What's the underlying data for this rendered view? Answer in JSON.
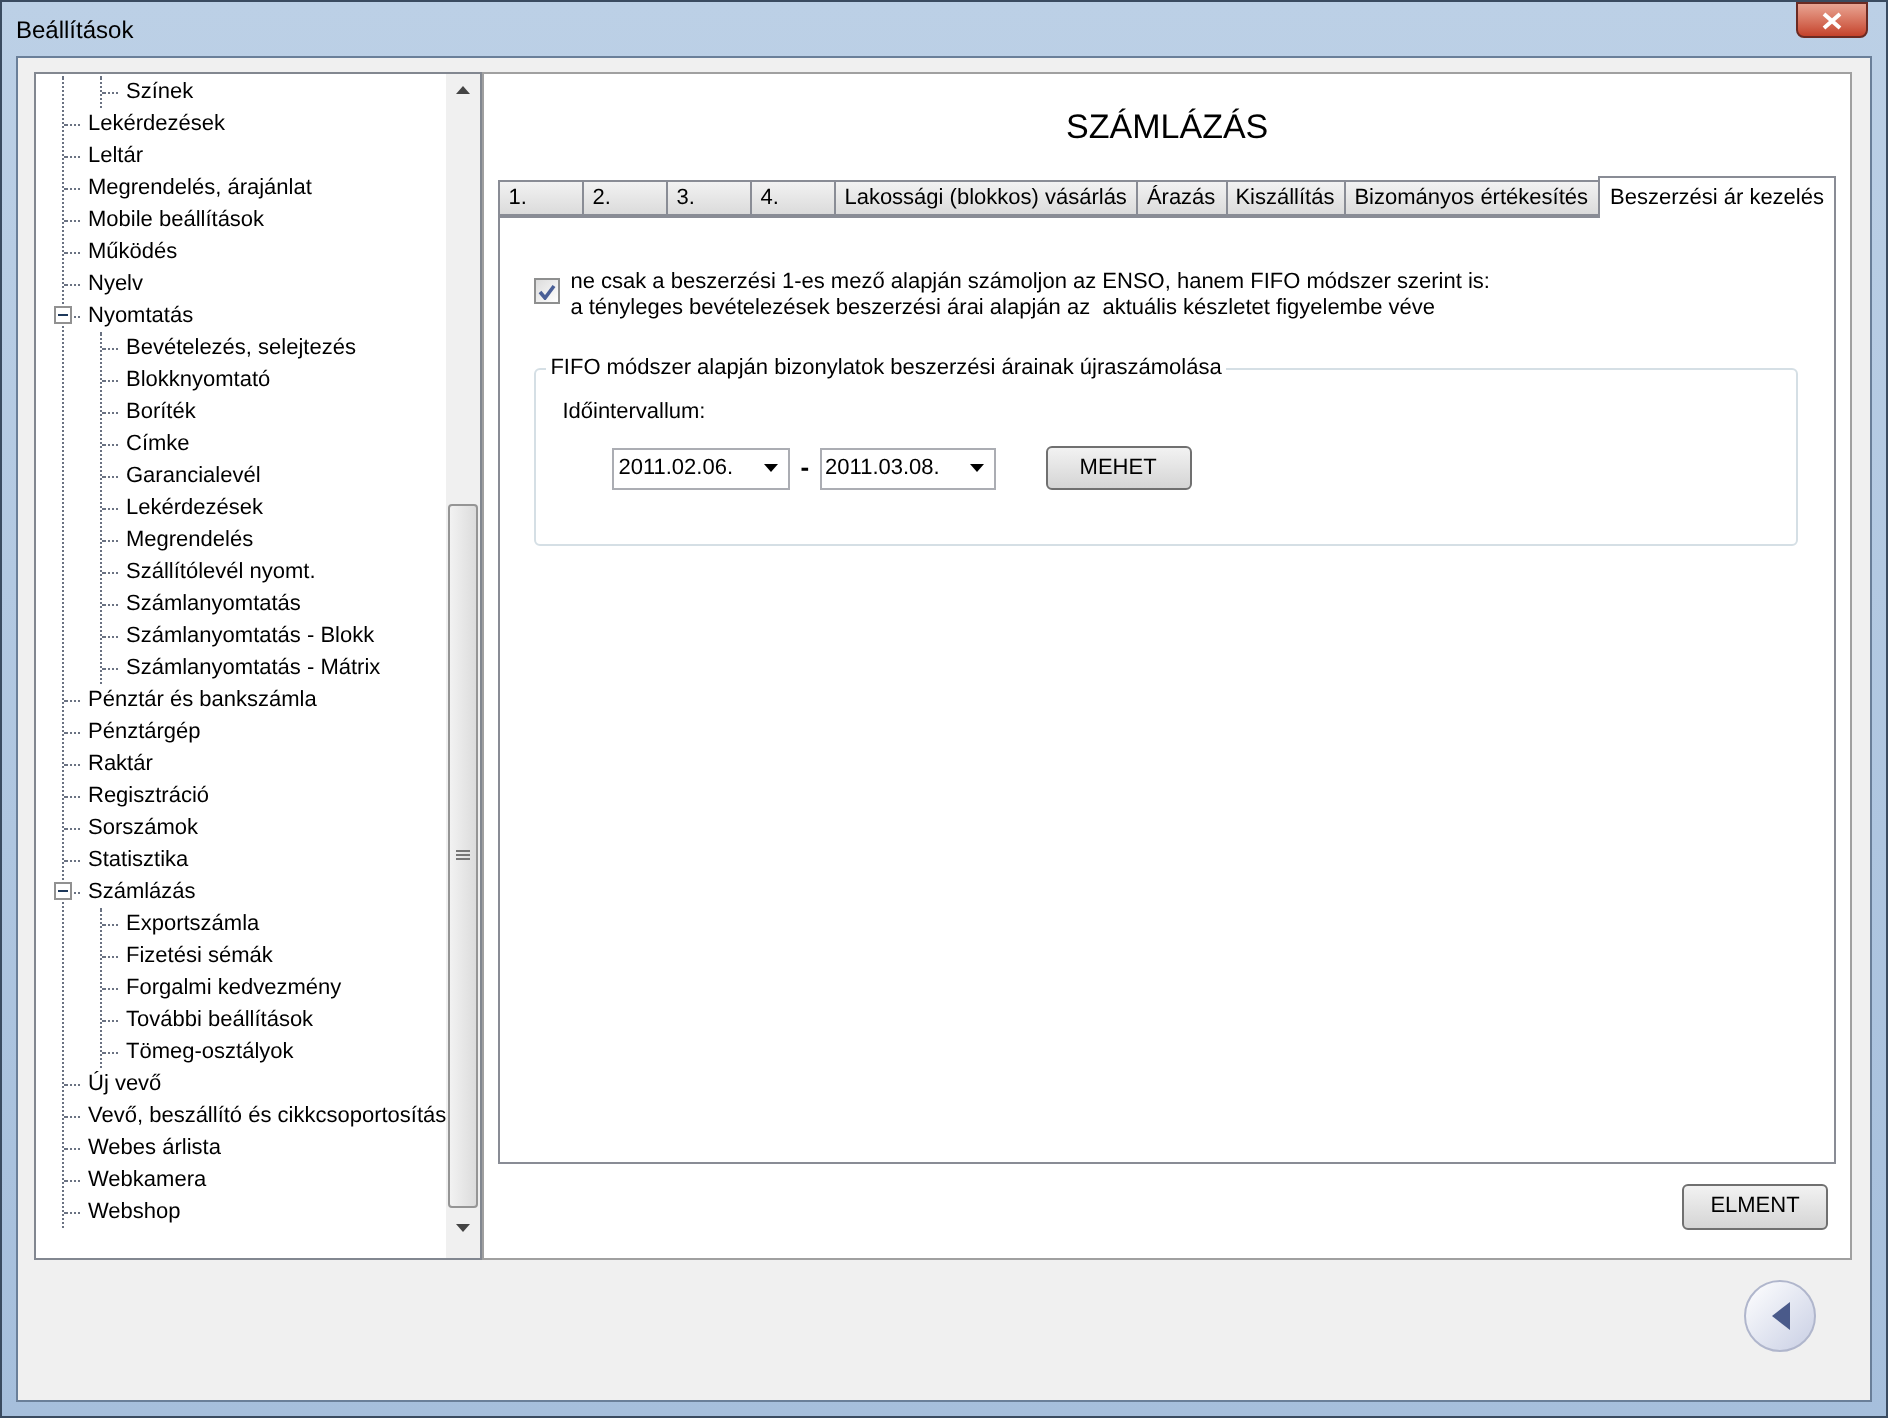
{
  "window": {
    "title": "Beállítások"
  },
  "tree": [
    {
      "children": [
        {
          "label": "Színek"
        }
      ]
    },
    {
      "label": "Lekérdezések"
    },
    {
      "label": "Leltár"
    },
    {
      "label": "Megrendelés, árajánlat"
    },
    {
      "label": "Mobile beállítások"
    },
    {
      "label": "Működés"
    },
    {
      "label": "Nyelv"
    },
    {
      "label": "Nyomtatás",
      "expanded": true,
      "children": [
        {
          "label": "Bevételezés, selejtezés"
        },
        {
          "label": "Blokknyomtató"
        },
        {
          "label": "Boríték"
        },
        {
          "label": "Címke"
        },
        {
          "label": "Garancialevél"
        },
        {
          "label": "Lekérdezések"
        },
        {
          "label": "Megrendelés"
        },
        {
          "label": "Szállítólevél nyomt."
        },
        {
          "label": "Számlanyomtatás"
        },
        {
          "label": "Számlanyomtatás - Blokk"
        },
        {
          "label": "Számlanyomtatás - Mátrix"
        }
      ]
    },
    {
      "label": "Pénztár és bankszámla"
    },
    {
      "label": "Pénztárgép"
    },
    {
      "label": "Raktár"
    },
    {
      "label": "Regisztráció"
    },
    {
      "label": "Sorszámok"
    },
    {
      "label": "Statisztika"
    },
    {
      "label": "Számlázás",
      "expanded": true,
      "children": [
        {
          "label": "Exportszámla"
        },
        {
          "label": "Fizetési sémák"
        },
        {
          "label": "Forgalmi kedvezmény"
        },
        {
          "label": "További beállítások"
        },
        {
          "label": "Tömeg-osztályok"
        }
      ]
    },
    {
      "label": "Új vevő"
    },
    {
      "label": "Vevő, beszállító és cikkcsoportosítás"
    },
    {
      "label": "Webes árlista"
    },
    {
      "label": "Webkamera"
    },
    {
      "label": "Webshop"
    }
  ],
  "page_title": "SZÁMLÁZÁS",
  "tabs": [
    {
      "label": "1.",
      "selected": false
    },
    {
      "label": "2.",
      "selected": false
    },
    {
      "label": "3.",
      "selected": false
    },
    {
      "label": "4.",
      "selected": false
    },
    {
      "label": "Lakossági (blokkos) vásárlás",
      "selected": false
    },
    {
      "label": "Árazás",
      "selected": false
    },
    {
      "label": "Kiszállítás",
      "selected": false
    },
    {
      "label": "Bizományos értékesítés",
      "selected": false
    },
    {
      "label": "Beszerzési ár kezelés",
      "selected": true
    }
  ],
  "fifo_option": {
    "checked": true,
    "label": "ne csak a beszerzési 1-es mező alapján számoljon az ENSO, hanem FIFO módszer szerint is:\na tényleges bevételezések beszerzési árai alapján az  aktuális készletet figyelembe véve"
  },
  "fifo_group": {
    "legend": "FIFO módszer alapján bizonylatok beszerzési árainak újraszámolása",
    "interval_label": "Időintervallum:",
    "from": "2011.02.06.",
    "separator": "-",
    "to": "2011.03.08.",
    "button": "MEHET"
  },
  "save_button": "ELMENT"
}
